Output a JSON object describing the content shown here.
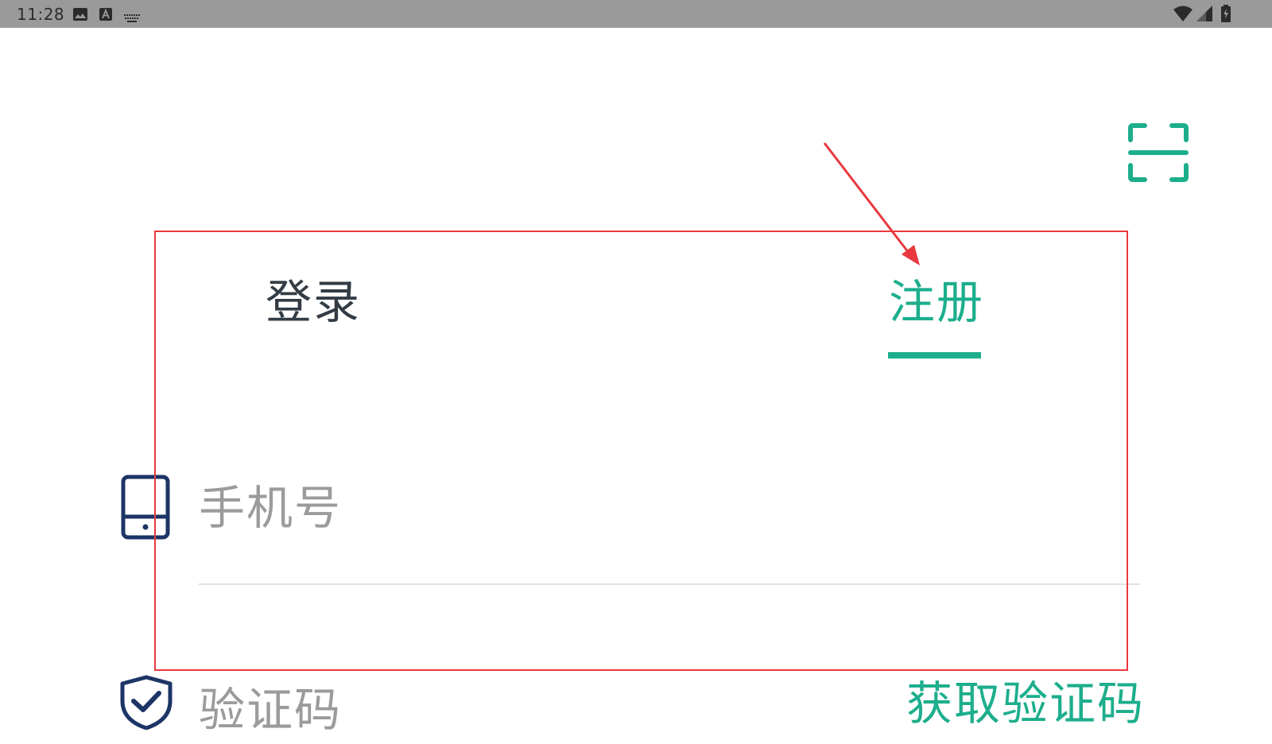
{
  "status_bar": {
    "time": "11:28",
    "icons": [
      "image-icon",
      "font-a-icon",
      "keyboard-icon",
      "wifi-icon",
      "signal-icon",
      "battery-icon"
    ]
  },
  "header": {
    "scan_icon": "scan-icon"
  },
  "tabs": [
    {
      "label": "登录",
      "active": false
    },
    {
      "label": "注册",
      "active": true
    }
  ],
  "form": {
    "phone": {
      "placeholder": "手机号",
      "value": "",
      "icon": "phone-icon"
    },
    "code": {
      "placeholder": "验证码",
      "value": "",
      "icon": "shield-check-icon"
    },
    "get_code_label": "获取验证码"
  },
  "colors": {
    "accent": "#1dae8c",
    "tab_inactive": "#333c44",
    "placeholder": "#9b9b9b",
    "icon_navy": "#1c3566",
    "annotation": "#e8393f",
    "status_bar": "#9a9a9a"
  }
}
